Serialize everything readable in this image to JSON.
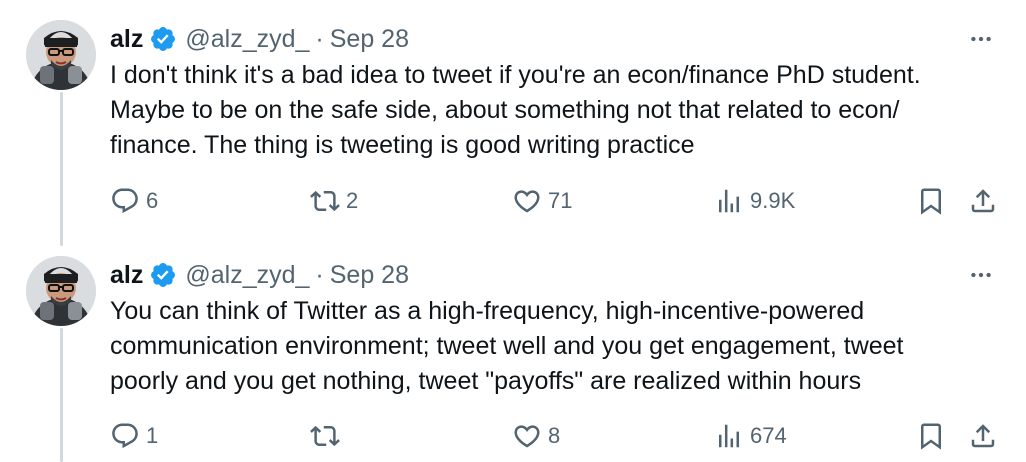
{
  "tweets": [
    {
      "name": "alz",
      "handle": "@alz_zyd_",
      "separator": "·",
      "date": "Sep 28",
      "text_lines": [
        "I don't think it's a bad idea to tweet if you're an econ/finance PhD student.",
        "Maybe to be on the safe side, about something not that related to econ/",
        "finance. The thing is tweeting is good writing practice"
      ],
      "replies": "6",
      "retweets": "2",
      "likes": "71",
      "views": "9.9K"
    },
    {
      "name": "alz",
      "handle": "@alz_zyd_",
      "separator": "·",
      "date": "Sep 28",
      "text_lines": [
        "You can think of Twitter as a high-frequency, high-incentive-powered",
        "communication environment; tweet well and you get engagement, tweet",
        "poorly and you get nothing, tweet \"payoffs\" are realized within hours"
      ],
      "replies": "1",
      "retweets": "",
      "likes": "8",
      "views": "674"
    }
  ],
  "colors": {
    "text": "#0f1419",
    "secondary": "#536471",
    "verified": "#1d9bf0",
    "thread_line": "#cfd9de"
  },
  "icons": [
    "avatar",
    "verified-badge-icon",
    "more-icon",
    "reply-icon",
    "retweet-icon",
    "like-icon",
    "views-icon",
    "bookmark-icon",
    "share-icon"
  ]
}
